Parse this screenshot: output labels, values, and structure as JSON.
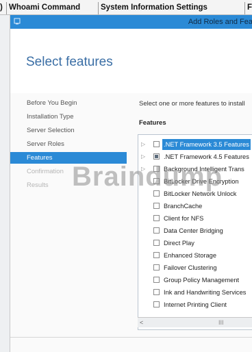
{
  "tabs": [
    {
      "label": "Whoami Command"
    },
    {
      "label": "System Information Settings"
    },
    {
      "label": "F"
    }
  ],
  "tab_lead": ")",
  "window": {
    "title": "Add Roles and Fea",
    "icon": "server-manager-icon"
  },
  "page_title": "Select features",
  "nav": {
    "items": [
      {
        "label": "Before You Begin",
        "state": "normal"
      },
      {
        "label": "Installation Type",
        "state": "normal"
      },
      {
        "label": "Server Selection",
        "state": "normal"
      },
      {
        "label": "Server Roles",
        "state": "normal"
      },
      {
        "label": "Features",
        "state": "active"
      },
      {
        "label": "Confirmation",
        "state": "disabled"
      },
      {
        "label": "Results",
        "state": "disabled"
      }
    ]
  },
  "content": {
    "description": "Select one or more features to install",
    "features_label": "Features"
  },
  "features": [
    {
      "label": ".NET Framework 3.5 Features",
      "expandable": true,
      "checkbox": "unchecked",
      "selected": true
    },
    {
      "label": ".NET Framework 4.5 Features",
      "expandable": true,
      "checkbox": "partial",
      "selected": false
    },
    {
      "label": "Background Intelligent Trans",
      "expandable": true,
      "checkbox": "unchecked",
      "selected": false
    },
    {
      "label": "BitLocker Drive Encryption",
      "expandable": false,
      "checkbox": "unchecked",
      "selected": false
    },
    {
      "label": "BitLocker Network Unlock",
      "expandable": false,
      "checkbox": "unchecked",
      "selected": false
    },
    {
      "label": "BranchCache",
      "expandable": false,
      "checkbox": "unchecked",
      "selected": false
    },
    {
      "label": "Client for NFS",
      "expandable": false,
      "checkbox": "unchecked",
      "selected": false
    },
    {
      "label": "Data Center Bridging",
      "expandable": false,
      "checkbox": "unchecked",
      "selected": false
    },
    {
      "label": "Direct Play",
      "expandable": false,
      "checkbox": "unchecked",
      "selected": false
    },
    {
      "label": "Enhanced Storage",
      "expandable": false,
      "checkbox": "unchecked",
      "selected": false
    },
    {
      "label": "Failover Clustering",
      "expandable": false,
      "checkbox": "unchecked",
      "selected": false
    },
    {
      "label": "Group Policy Management",
      "expandable": false,
      "checkbox": "unchecked",
      "selected": false
    },
    {
      "label": "Ink and Handwriting Services",
      "expandable": false,
      "checkbox": "unchecked",
      "selected": false
    },
    {
      "label": "Internet Printing Client",
      "expandable": false,
      "checkbox": "unchecked",
      "selected": false
    }
  ],
  "scrollbar": {
    "left_arrow": "<",
    "thumb": "III"
  },
  "watermark": "Braindump",
  "colors": {
    "accent": "#2b8ad6",
    "title": "#3a6ea5"
  }
}
